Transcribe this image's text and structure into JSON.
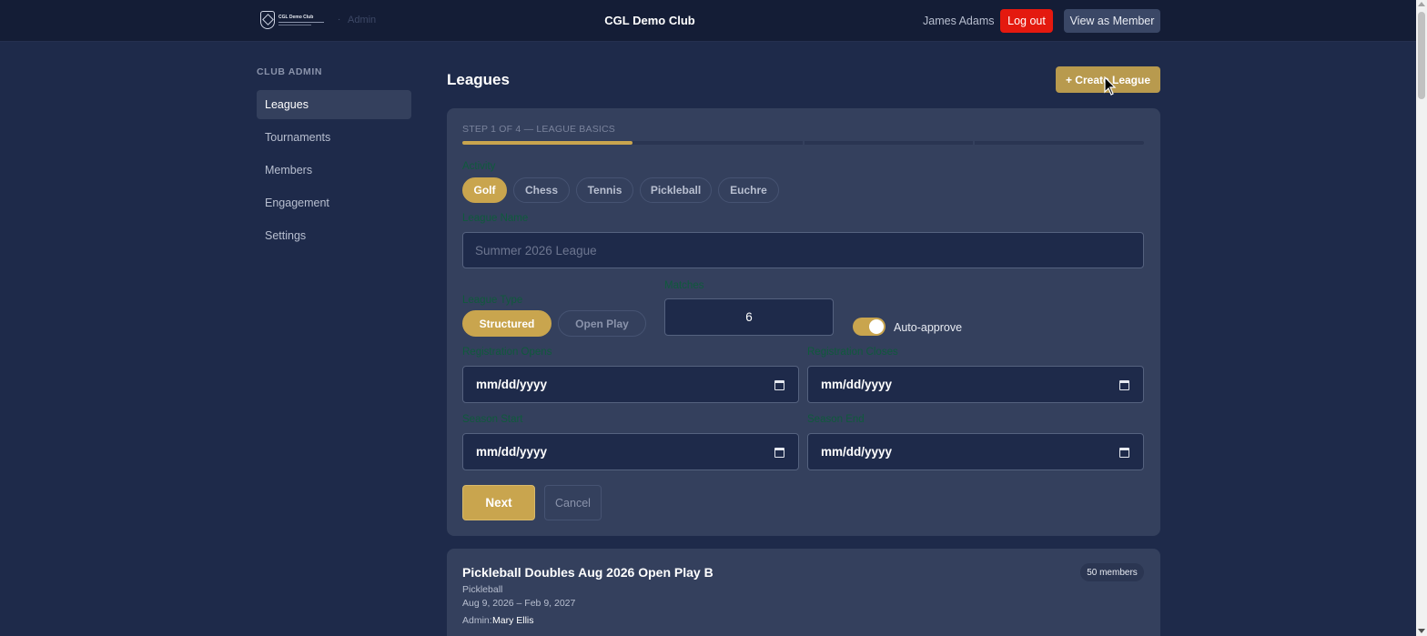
{
  "header": {
    "logo_text": "CGL Demo Club",
    "breadcrumb_section": "Admin",
    "club_name": "CGL Demo Club",
    "user_name": "James Adams",
    "logout_label": "Log out",
    "view_member_label": "View as Member"
  },
  "sidebar": {
    "heading": "CLUB ADMIN",
    "items": [
      {
        "label": "Leagues",
        "active": true
      },
      {
        "label": "Tournaments",
        "active": false
      },
      {
        "label": "Members",
        "active": false
      },
      {
        "label": "Engagement",
        "active": false
      },
      {
        "label": "Settings",
        "active": false
      }
    ]
  },
  "main": {
    "title": "Leagues",
    "create_button": "+ Create League"
  },
  "wizard": {
    "step_label": "STEP 1 OF 4 — LEAGUE BASICS",
    "progress": {
      "current_step": 1,
      "total_steps": 4
    },
    "activity_label": "Activity",
    "activities": [
      {
        "label": "Golf",
        "selected": true
      },
      {
        "label": "Chess",
        "selected": false
      },
      {
        "label": "Tennis",
        "selected": false
      },
      {
        "label": "Pickleball",
        "selected": false
      },
      {
        "label": "Euchre",
        "selected": false
      }
    ],
    "league_name_label": "League Name",
    "league_name_placeholder": "Summer 2026 League",
    "league_type_label": "League Type",
    "league_types": [
      {
        "label": "Structured",
        "selected": true
      },
      {
        "label": "Open Play",
        "selected": false
      }
    ],
    "matches_label": "Matches",
    "matches_value": "6",
    "auto_approve_label": "Auto-approve",
    "auto_approve_on": true,
    "registration_opens_label": "Registration Opens",
    "registration_opens_value": "mm/dd/yyyy",
    "registration_closes_label": "Registration Closes",
    "registration_closes_value": "mm/dd/yyyy",
    "season_start_label": "Season Start",
    "season_start_value": "mm/dd/yyyy",
    "season_end_label": "Season End",
    "season_end_value": "mm/dd/yyyy",
    "next_label": "Next",
    "cancel_label": "Cancel"
  },
  "leagues": [
    {
      "title": "Pickleball Doubles Aug 2026 Open Play B",
      "activity": "Pickleball",
      "dates": "Aug 9, 2026 – Feb 9, 2027",
      "admin_label": "Admin:",
      "admin_name": "Mary Ellis",
      "members": "50 members"
    }
  ],
  "colors": {
    "accent_gold": "#c9a54e",
    "background": "#1e2a4a",
    "card": "#34405d",
    "logout_red": "#e4190f"
  }
}
